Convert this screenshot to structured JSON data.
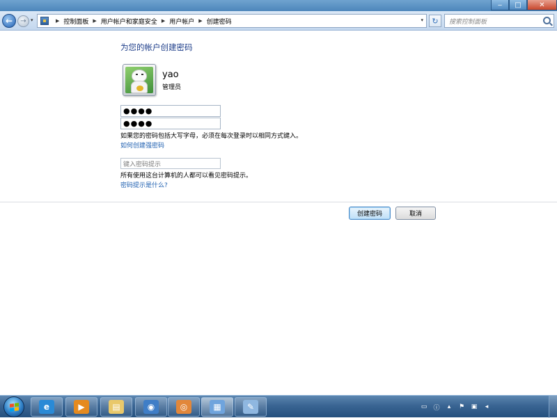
{
  "window": {
    "minimize_icon": "minimize-icon",
    "maximize_icon": "maximize-icon",
    "close_icon": "close-icon"
  },
  "nav": {
    "back_glyph": "←",
    "forward_glyph": "→",
    "breadcrumb": [
      "控制面板",
      "用户帐户和家庭安全",
      "用户帐户",
      "创建密码"
    ],
    "separator": "▶",
    "refresh_glyph": "↻",
    "search_placeholder": "搜索控制面板"
  },
  "content": {
    "title": "为您的帐户创建密码",
    "user": {
      "name": "yao",
      "role": "管理员"
    },
    "password_value": "●●●●",
    "confirm_value": "●●●●",
    "case_note": "如果您的密码包括大写字母，必须在每次登录时以相同方式键入。",
    "strong_password_link": "如何创建强密码",
    "hint_placeholder": "键入密码提示",
    "hint_note": "所有使用这台计算机的人都可以看见密码提示。",
    "hint_link": "密码提示是什么?",
    "create_button": "创建密码",
    "cancel_button": "取消"
  },
  "taskbar": {
    "apps": [
      {
        "name": "internet-explorer",
        "icon": "ie-icon",
        "glyph": "e",
        "color": "#2a8ad6"
      },
      {
        "name": "media-player",
        "icon": "media-player-icon",
        "glyph": "▶",
        "color": "#e58a1f"
      },
      {
        "name": "file-explorer",
        "icon": "folder-icon",
        "glyph": "▤",
        "color": "#e9c86a"
      },
      {
        "name": "network",
        "icon": "network-icon",
        "glyph": "◉",
        "color": "#3f7ec7"
      },
      {
        "name": "camera",
        "icon": "camera-icon",
        "glyph": "◎",
        "color": "#e2873a"
      },
      {
        "name": "control-panel",
        "icon": "control-panel-icon",
        "glyph": "▦",
        "color": "#6fa4dd"
      },
      {
        "name": "paint",
        "icon": "paint-icon",
        "glyph": "✎",
        "color": "#8fb7e0"
      }
    ]
  }
}
